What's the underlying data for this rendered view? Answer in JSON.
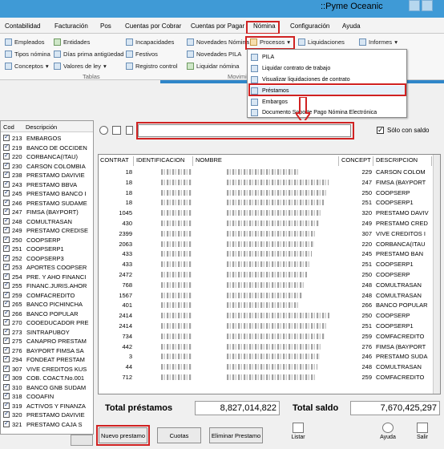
{
  "window": {
    "title": "::Pyme Oceanic"
  },
  "menu": [
    "Contabilidad",
    "Facturación",
    "Pos",
    "Cuentas por Cobrar",
    "Cuentas por Pagar",
    "Nómina",
    "Configuración",
    "Ayuda"
  ],
  "ribbon": {
    "col1": [
      "Empleados",
      "Tipos nómina",
      "Conceptos"
    ],
    "col2": [
      "Entidades",
      "Días prima antigüedad",
      "Valores de ley"
    ],
    "col3": [
      "Incapacidades",
      "Festivos",
      "Registro control"
    ],
    "col4": [
      "Novedades Nómina",
      "Novedades PILA",
      "Liquidar nómina"
    ],
    "procesos": "Procesos",
    "liquidaciones": "Liquidaciones",
    "informes": "Informes",
    "group_tablas": "Tablas",
    "group_movim": "Movimi"
  },
  "dropdown": [
    "PILA",
    "Liquidar contrato de trabajo",
    "Visualizar liquidaciones de contrato",
    "Préstamos",
    "Embargos",
    "Documento Soporte Pago Nómina Electrónica"
  ],
  "leftlist": {
    "headers": {
      "cod": "Cod",
      "desc": "Descripción"
    },
    "rows": [
      {
        "cod": "213",
        "desc": "EMBARGOS"
      },
      {
        "cod": "219",
        "desc": "BANCO DE OCCIDEN"
      },
      {
        "cod": "220",
        "desc": "CORBANCA(ITAU)"
      },
      {
        "cod": "230",
        "desc": "CARSON COLOMBIA"
      },
      {
        "cod": "238",
        "desc": "PRESTAMO DAVIVIE"
      },
      {
        "cod": "243",
        "desc": "PRESTAMO BBVA"
      },
      {
        "cod": "245",
        "desc": "PRESTAMO BANCO I"
      },
      {
        "cod": "246",
        "desc": "PRESTAMO SUDAME"
      },
      {
        "cod": "247",
        "desc": "FIMSA (BAYPORT)"
      },
      {
        "cod": "248",
        "desc": "COMULTRASAN"
      },
      {
        "cod": "249",
        "desc": "PRESTAMO CREDISE"
      },
      {
        "cod": "250",
        "desc": "COOPSERP"
      },
      {
        "cod": "251",
        "desc": "COOPSERP1"
      },
      {
        "cod": "252",
        "desc": "COOPSERP3"
      },
      {
        "cod": "253",
        "desc": "APORTES COOPSER"
      },
      {
        "cod": "254",
        "desc": "PRE. Y AHO FINANCI"
      },
      {
        "cod": "255",
        "desc": "FINANC.JURIS.AHOR"
      },
      {
        "cod": "259",
        "desc": "COMFACREDITO"
      },
      {
        "cod": "265",
        "desc": "BANCO PICHINCHA"
      },
      {
        "cod": "266",
        "desc": "BANCO POPULAR"
      },
      {
        "cod": "270",
        "desc": "COOEDUCADOR PRE"
      },
      {
        "cod": "273",
        "desc": "SINTRAPUBOY"
      },
      {
        "cod": "275",
        "desc": "CANAPRO PRESTAM"
      },
      {
        "cod": "276",
        "desc": "BAYPORT FIMSA SA"
      },
      {
        "cod": "294",
        "desc": "FONDEAT PRESTAM"
      },
      {
        "cod": "307",
        "desc": "VIVE CREDITOS KUS"
      },
      {
        "cod": "309",
        "desc": "COB. COACT.No.001"
      },
      {
        "cod": "310",
        "desc": "BANCO GNB SUDAM"
      },
      {
        "cod": "318",
        "desc": "COOAFIN"
      },
      {
        "cod": "319",
        "desc": "ACTIVOS Y FINANZA"
      },
      {
        "cod": "320",
        "desc": "PRESTAMO DAVIVIE"
      },
      {
        "cod": "321",
        "desc": "PRESTAMO CAJA S"
      }
    ]
  },
  "main": {
    "search_value": "",
    "solo_con_saldo": "Sólo con saldo",
    "headers": [
      "CONTRAT",
      "IDENTIFICACION",
      "NOMBRE",
      "CONCEPT",
      "DESCRIPCION"
    ],
    "rows": [
      {
        "contrato": "18",
        "concepto": "229",
        "descripcion": "CARSON COLOM"
      },
      {
        "contrato": "18",
        "concepto": "247",
        "descripcion": "FIMSA (BAYPORT"
      },
      {
        "contrato": "18",
        "concepto": "250",
        "descripcion": "COOPSERP"
      },
      {
        "contrato": "18",
        "concepto": "251",
        "descripcion": "COOPSERP1"
      },
      {
        "contrato": "1045",
        "concepto": "320",
        "descripcion": "PRESTAMO DAVIV"
      },
      {
        "contrato": "430",
        "concepto": "249",
        "descripcion": "PRESTAMO CRED"
      },
      {
        "contrato": "2399",
        "concepto": "307",
        "descripcion": "VIVE CREDITOS I"
      },
      {
        "contrato": "2063",
        "concepto": "220",
        "descripcion": "CORBANCA(ITAU"
      },
      {
        "contrato": "433",
        "concepto": "245",
        "descripcion": "PRESTAMO BAN"
      },
      {
        "contrato": "433",
        "concepto": "251",
        "descripcion": "COOPSERP1"
      },
      {
        "contrato": "2472",
        "concepto": "250",
        "descripcion": "COOPSERP"
      },
      {
        "contrato": "768",
        "concepto": "248",
        "descripcion": "COMULTRASAN"
      },
      {
        "contrato": "1567",
        "concepto": "248",
        "descripcion": "COMULTRASAN"
      },
      {
        "contrato": "401",
        "concepto": "266",
        "descripcion": "BANCO POPULAR"
      },
      {
        "contrato": "2414",
        "concepto": "250",
        "descripcion": "COOPSERP"
      },
      {
        "contrato": "2414",
        "concepto": "251",
        "descripcion": "COOPSERP1"
      },
      {
        "contrato": "734",
        "concepto": "259",
        "descripcion": "COMFACREDITO"
      },
      {
        "contrato": "442",
        "concepto": "276",
        "descripcion": "FIMSA (BAYPORT"
      },
      {
        "contrato": "3",
        "concepto": "246",
        "descripcion": "PRESTAMO SUDA"
      },
      {
        "contrato": "44",
        "concepto": "248",
        "descripcion": "COMULTRASAN"
      },
      {
        "contrato": "712",
        "concepto": "259",
        "descripcion": "COMFACREDITO"
      }
    ]
  },
  "totals": {
    "total_prestamos_label": "Total préstamos",
    "total_prestamos": "8,827,014,822",
    "total_saldo_label": "Total saldo",
    "total_saldo": "7,670,425,297"
  },
  "buttons": {
    "nuevo": "Nuevo prestamo",
    "cuotas": "Cuotas",
    "eliminar": "Eliminar Prestamo",
    "listar": "Listar",
    "ayuda": "Ayuda",
    "salir": "Salir"
  },
  "colors": {
    "accent": "#3f9ad6",
    "highlight": "#d02222"
  }
}
